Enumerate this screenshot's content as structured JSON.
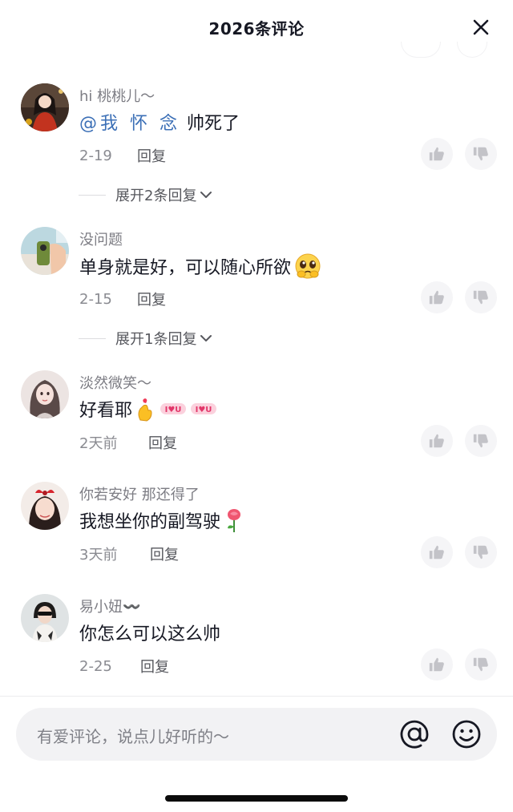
{
  "header": {
    "title": "2026条评论"
  },
  "comments": [
    {
      "username": "hi 桃桃儿～",
      "mention": "@我 怀 念",
      "text": "帅死了",
      "date": "2-19",
      "reply_label": "回复",
      "expand_label": "展开2条回复"
    },
    {
      "username": "没问题",
      "text": "单身就是好，可以随心所欲",
      "emoji": "pleading-face",
      "date": "2-15",
      "reply_label": "回复",
      "expand_label": "展开1条回复"
    },
    {
      "username": "淡然微笑～",
      "text": "好看耶",
      "emoji": "finger-heart-and-love-stickers",
      "date": "2天前",
      "reply_label": "回复"
    },
    {
      "username": "你若安好 那还得了",
      "text": "我想坐你的副驾驶",
      "emoji": "rose",
      "date": "3天前",
      "reply_label": "回复"
    },
    {
      "username": "易小妞〰️",
      "text": "你怎么可以这么帅",
      "date": "2-25",
      "reply_label": "回复"
    }
  ],
  "input": {
    "placeholder": "有爱评论，说点儿好听的～"
  },
  "colors": {
    "mention": "#3b6fb6",
    "secondary_text": "#8a8b91",
    "button_bg": "#f5f5f7"
  }
}
